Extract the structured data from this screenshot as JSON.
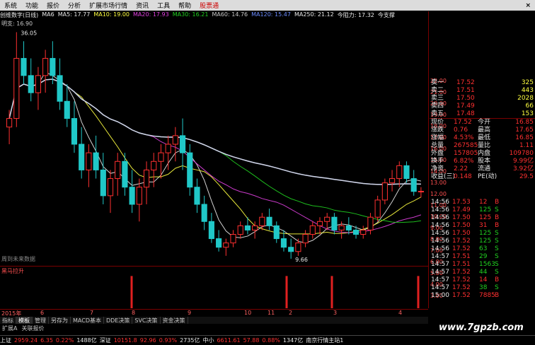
{
  "menu": {
    "items": [
      "系统",
      "功能",
      "报价",
      "分析",
      "扩展市场行情",
      "资讯",
      "工具",
      "帮助"
    ],
    "stock_badge": "股票通",
    "close": "×"
  },
  "ma_line": {
    "title": "创维数字(日线)",
    "items": [
      {
        "label": "MA6",
        "color": "#e8e8e8"
      },
      {
        "label": "MA5: 17.77",
        "color": "#e8e8e8"
      },
      {
        "label": "MA10: 19.00",
        "color": "#ffff40"
      },
      {
        "label": "MA20: 17.93",
        "color": "#e040e0"
      },
      {
        "label": "MA30: 16.21",
        "color": "#20d020"
      },
      {
        "label": "MA60: 14.76",
        "color": "#c8c8c8"
      },
      {
        "label": "MA120: 15.47",
        "color": "#6c8cff"
      },
      {
        "label": "MA250: 21.12",
        "color": "#e8e8e8"
      },
      {
        "label": "今阻力: 17.32",
        "color": "#e8e8e8"
      },
      {
        "label": "今支撑",
        "color": "#e8e8e8"
      }
    ]
  },
  "ref_price": "明支: 16.90",
  "annotations": {
    "high": "36.05",
    "low": "9.66"
  },
  "future_note": "周到未来数据",
  "sub_indicator": "黑马拉升",
  "x_axis": [
    {
      "label": "2015年"
    },
    {
      "label": "6"
    },
    {
      "label": "7"
    },
    {
      "label": "8"
    },
    {
      "label": "9"
    },
    {
      "label": "10"
    },
    {
      "label": "11"
    },
    {
      "label": "2"
    },
    {
      "label": "3"
    },
    {
      "label": "4"
    }
  ],
  "y_axis": [
    "22.00",
    "21.00",
    "20.00",
    "19.00",
    "18.00",
    "17.00",
    "16.00",
    "15.00",
    "14.00",
    "13.00",
    "12.00",
    "11.00",
    "10.00",
    "9.00",
    "8.00",
    "7.00",
    "6.00",
    "5.00",
    "4.00",
    "3.00"
  ],
  "tabs": [
    "指标",
    "模板",
    "管理",
    "另存为",
    "MACD基本",
    "DDE决策",
    "SVC决策",
    "资金决策"
  ],
  "tabs2": [
    "扩展A",
    "关联报价"
  ],
  "quote": {
    "sell": [
      {
        "label": "卖一",
        "price": "17.52",
        "vol": "325"
      },
      {
        "label": "卖二",
        "price": "17.51",
        "vol": "443"
      },
      {
        "label": "卖三",
        "price": "17.50",
        "vol": "2028"
      },
      {
        "label": "卖四",
        "price": "17.49",
        "vol": "66"
      },
      {
        "label": "卖五",
        "price": "17.48",
        "vol": "153"
      }
    ],
    "stats": [
      {
        "l1": "现价",
        "v1": "17.52",
        "l2": "今开",
        "v2": "16.85"
      },
      {
        "l1": "涨跌",
        "v1": "0.76",
        "l2": "最高",
        "v2": "17.65"
      },
      {
        "l1": "涨幅",
        "v1": "4.53%",
        "l2": "最低",
        "v2": "16.85"
      },
      {
        "l1": "总量",
        "v1": "267585",
        "l2": "量比",
        "v2": "1.11"
      },
      {
        "l1": "外盘",
        "v1": "157805",
        "l2": "内盘",
        "v2": "109780"
      },
      {
        "l1": "换手",
        "v1": "6.82%",
        "l2": "股本",
        "v2": "9.99亿"
      },
      {
        "l1": "净资",
        "v1": "2.22",
        "l2": "流通",
        "v2": "3.92亿"
      },
      {
        "l1": "收益(三)",
        "v1": "0.148",
        "l2": "PE(动)",
        "v2": "29.5"
      }
    ]
  },
  "ticks": [
    {
      "t": "14:56",
      "p": "17.53",
      "v": "12",
      "d": "B"
    },
    {
      "t": "14:56",
      "p": "17.49",
      "v": "125",
      "d": "S"
    },
    {
      "t": "14:56",
      "p": "17.50",
      "v": "125",
      "d": "B"
    },
    {
      "t": "14:56",
      "p": "17.50",
      "v": "31",
      "d": "B"
    },
    {
      "t": "14:56",
      "p": "17.50",
      "v": "125",
      "d": "S"
    },
    {
      "t": "14:56",
      "p": "17.52",
      "v": "125",
      "d": "S"
    },
    {
      "t": "14:56",
      "p": "17.52",
      "v": "63",
      "d": "S"
    },
    {
      "t": "14:57",
      "p": "17.51",
      "v": "29",
      "d": "S"
    },
    {
      "t": "14:57",
      "p": "17.51",
      "v": "1563",
      "d": "S"
    },
    {
      "t": "14:57",
      "p": "17.52",
      "v": "44",
      "d": "S"
    },
    {
      "t": "14:57",
      "p": "17.52",
      "v": "14",
      "d": "B"
    },
    {
      "t": "14:57",
      "p": "17.52",
      "v": "38",
      "d": "S"
    },
    {
      "t": "15:00",
      "p": "17.52",
      "v": "7885",
      "d": "B"
    }
  ],
  "status": [
    {
      "text": "上证",
      "c": "white"
    },
    {
      "text": "2959.24",
      "c": "red"
    },
    {
      "text": "6.35",
      "c": "red"
    },
    {
      "text": "0.22%",
      "c": "red"
    },
    {
      "text": "1488亿",
      "c": "white"
    },
    {
      "text": "深证",
      "c": "white"
    },
    {
      "text": "10151.8",
      "c": "red"
    },
    {
      "text": "92.96",
      "c": "red"
    },
    {
      "text": "0.93%",
      "c": "red"
    },
    {
      "text": "2735亿",
      "c": "white"
    },
    {
      "text": "中小",
      "c": "white"
    },
    {
      "text": "6611.61",
      "c": "red"
    },
    {
      "text": "57.88",
      "c": "red"
    },
    {
      "text": "0.88%",
      "c": "red"
    },
    {
      "text": "1347亿",
      "c": "white"
    },
    {
      "text": "南京行情主站1",
      "c": "white"
    }
  ],
  "watermark": "www.7gpzb.com",
  "colors": {
    "up": "#ff3030",
    "down": "#20c8c8",
    "ma5": "#e8e8e8",
    "ma10": "#ffff40",
    "ma20": "#e040e0",
    "ma30": "#20d020",
    "ma120": "#2040c0",
    "ma250": "#e8e8e8"
  },
  "chart_data": {
    "type": "candlestick",
    "y_range": [
      9,
      37
    ],
    "candles": [
      [
        25,
        27,
        23,
        26
      ],
      [
        26,
        36.05,
        25,
        33
      ],
      [
        33,
        35,
        30,
        31
      ],
      [
        31,
        33,
        28,
        29
      ],
      [
        29,
        32,
        27,
        31
      ],
      [
        31,
        34,
        29,
        33
      ],
      [
        33,
        35,
        30,
        31
      ],
      [
        31,
        33,
        27,
        28
      ],
      [
        28,
        30,
        25,
        26
      ],
      [
        26,
        28,
        22,
        23
      ],
      [
        23,
        25,
        19,
        20
      ],
      [
        20,
        23,
        18,
        22
      ],
      [
        22,
        24,
        19,
        20
      ],
      [
        20,
        22,
        16,
        17
      ],
      [
        17,
        20,
        15,
        19
      ],
      [
        19,
        22,
        17,
        21
      ],
      [
        21,
        22,
        17,
        18
      ],
      [
        18,
        20,
        15,
        16
      ],
      [
        16,
        19,
        14,
        18
      ],
      [
        18,
        21,
        16,
        20
      ],
      [
        20,
        22,
        18,
        21
      ],
      [
        21,
        23,
        19,
        22
      ],
      [
        22,
        24,
        20,
        23
      ],
      [
        23,
        25,
        21,
        24
      ],
      [
        24,
        26,
        20,
        22
      ],
      [
        22,
        23,
        17,
        18
      ],
      [
        18,
        19,
        15,
        16
      ],
      [
        16,
        17,
        13,
        14
      ],
      [
        14,
        15,
        11.5,
        12
      ],
      [
        12,
        13,
        10.5,
        11
      ],
      [
        11,
        12,
        10,
        11.5
      ],
      [
        11.5,
        13,
        11,
        12.5
      ],
      [
        12.5,
        14,
        12,
        13.5
      ],
      [
        13.5,
        14.5,
        12.5,
        13
      ],
      [
        13,
        14,
        12,
        13.5
      ],
      [
        13.5,
        15,
        13,
        14.5
      ],
      [
        14.5,
        15.5,
        13,
        13.5
      ],
      [
        13.5,
        14,
        11.5,
        12
      ],
      [
        12,
        13,
        10.5,
        11
      ],
      [
        11,
        12,
        9.66,
        10.5
      ],
      [
        10.5,
        12,
        10,
        11.5
      ],
      [
        11.5,
        13,
        11,
        12.5
      ],
      [
        12.5,
        14,
        12,
        13.5
      ],
      [
        13.5,
        14.5,
        12.5,
        14
      ],
      [
        14,
        15,
        13,
        14.5
      ],
      [
        14.5,
        15,
        12.5,
        13
      ],
      [
        13,
        14,
        12,
        13.5
      ],
      [
        13.5,
        14.5,
        12.5,
        13
      ],
      [
        13,
        13.5,
        12,
        12.5
      ],
      [
        12.5,
        13.5,
        12,
        13
      ],
      [
        13,
        15,
        12.5,
        14.5
      ],
      [
        14.5,
        17,
        14,
        16.5
      ],
      [
        16.5,
        19,
        16,
        18.5
      ],
      [
        18.5,
        20,
        17.5,
        19
      ],
      [
        19,
        21,
        18,
        20.5
      ],
      [
        20.5,
        21,
        18.5,
        19
      ],
      [
        19,
        20,
        17,
        17.5
      ],
      [
        17.5,
        18,
        16.8,
        17.52
      ]
    ],
    "volume_spikes": [
      {
        "x": "8",
        "h": 0.95
      },
      {
        "x": "2",
        "h": 0.95
      },
      {
        "x": "3",
        "h": 0.95
      },
      {
        "x": "4",
        "h": 0.95
      }
    ]
  }
}
